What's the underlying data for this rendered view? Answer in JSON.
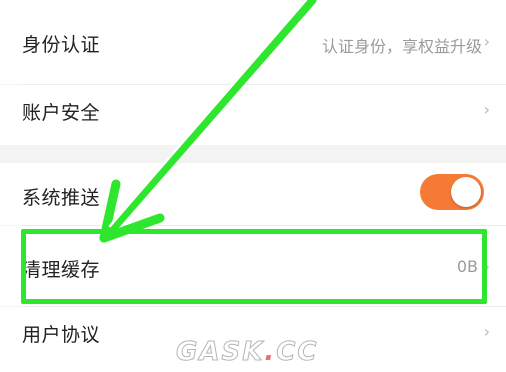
{
  "settings": {
    "identity": {
      "label": "身份认证",
      "value": "认证身份，享权益升级",
      "chevron": "›"
    },
    "account_security": {
      "label": "账户安全",
      "chevron": "›"
    },
    "push": {
      "label": "系统推送",
      "enabled": true
    },
    "clear_cache": {
      "label": "清理缓存",
      "value": "0B",
      "chevron": "›"
    },
    "user_agreement": {
      "label": "用户协议",
      "chevron": "›"
    }
  },
  "watermark": {
    "text_left": "GASK",
    "separator": ".",
    "text_right": "CC"
  },
  "colors": {
    "toggle_on": "#f47a36",
    "highlight": "#2ee62e",
    "page_bg": "#f5f5f5",
    "row_bg": "#ffffff"
  },
  "annotation": {
    "icon": "arrow-pointer",
    "color": "#2ee62e"
  }
}
